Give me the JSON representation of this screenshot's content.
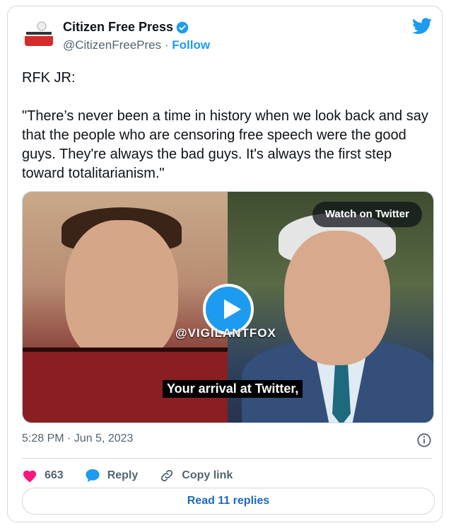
{
  "author": {
    "name": "Citizen Free Press",
    "handle": "@CitizenFreePres",
    "separator": "·",
    "follow_label": "Follow",
    "avatar_text": "CITIZEN FREE PRESS"
  },
  "tweet": {
    "lines": [
      "RFK JR:",
      "\"There’s never been a time in history when we look back and say that the people who are censoring free speech were the good guys. They're always the bad guys. It's always the first step toward totalitarianism.\""
    ]
  },
  "media": {
    "watch_label": "Watch on Twitter",
    "watermark": "@VIGILANTFOX",
    "caption": "Your arrival at Twitter,"
  },
  "meta": {
    "timestamp": "5:28 PM · Jun 5, 2023"
  },
  "actions": {
    "likes": "663",
    "reply_label": "Reply",
    "copy_label": "Copy link"
  },
  "read_replies_label": "Read 11 replies",
  "colors": {
    "accent": "#1d9bf0",
    "like": "#f91880",
    "text_secondary": "#536471"
  }
}
